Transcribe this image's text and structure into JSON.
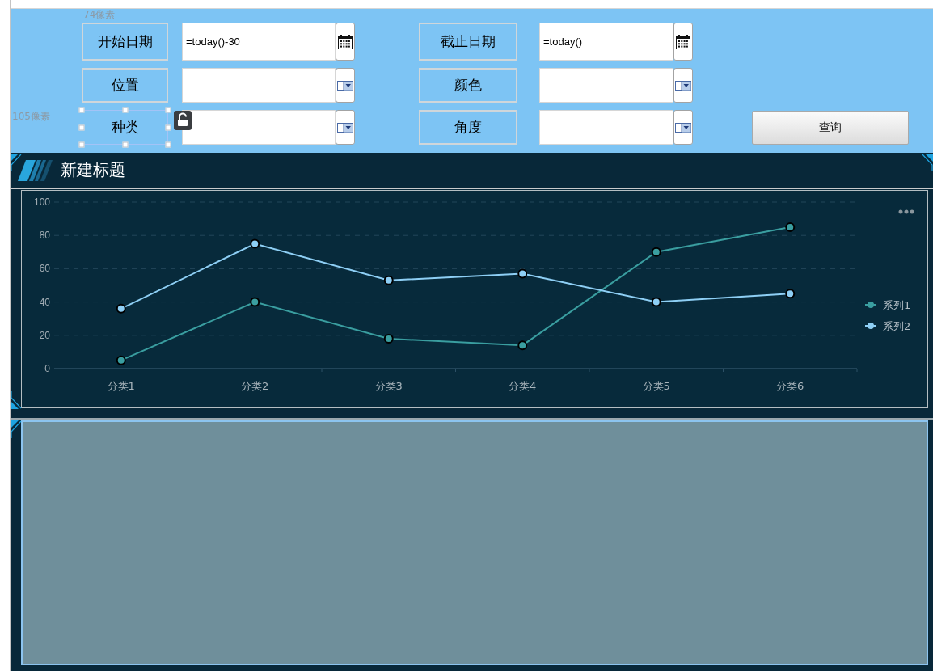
{
  "canvas_annotations": [
    {
      "text": "74像素"
    },
    {
      "text": "105像素"
    }
  ],
  "filters": [
    {
      "label": "开始日期",
      "selected": false,
      "kind": "date",
      "value": "=today()-30"
    },
    {
      "label": "截止日期",
      "selected": false,
      "kind": "date",
      "value": "=today()"
    },
    {
      "label": "位置",
      "selected": false,
      "kind": "select"
    },
    {
      "label": "颜色",
      "selected": false,
      "kind": "select"
    },
    {
      "label": "种类",
      "selected": true,
      "kind": "select"
    },
    {
      "label": "角度",
      "selected": false,
      "kind": "select"
    }
  ],
  "query_button": "查询",
  "chart_panel": {
    "title": "新建标题",
    "chart_data": {
      "type": "line",
      "categories": [
        "分类1",
        "分类2",
        "分类3",
        "分类4",
        "分类5",
        "分类6"
      ],
      "series": [
        {
          "name": "系列1",
          "color": "#3a9ea0",
          "marker": "circle",
          "values": [
            5,
            40,
            18,
            14,
            70,
            85
          ]
        },
        {
          "name": "系列2",
          "color": "#8ecff5",
          "marker": "circle",
          "values": [
            36,
            75,
            53,
            57,
            40,
            45
          ]
        }
      ],
      "ylim": [
        0,
        100
      ],
      "yticks": [
        0,
        20,
        40,
        60,
        80,
        100
      ],
      "grid": true,
      "legend": true
    }
  }
}
